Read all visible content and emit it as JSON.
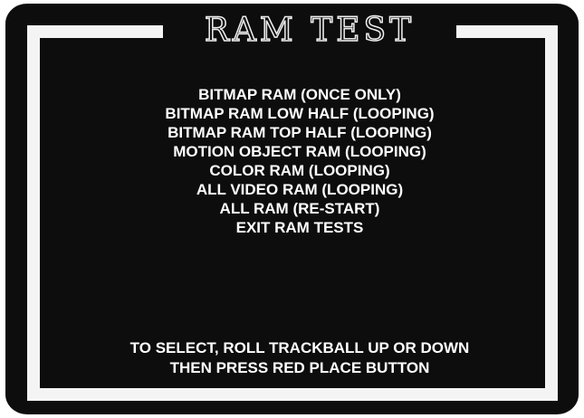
{
  "screen": {
    "title": "RAM TEST",
    "menu_items": [
      "BITMAP RAM (ONCE ONLY)",
      "BITMAP RAM LOW HALF (LOOPING)",
      "BITMAP RAM TOP HALF (LOOPING)",
      "MOTION OBJECT RAM (LOOPING)",
      "COLOR RAM (LOOPING)",
      "ALL VIDEO RAM (LOOPING)",
      "ALL RAM (RE-START)",
      "EXIT RAM TESTS"
    ],
    "instructions": [
      "TO SELECT, ROLL TRACKBALL UP OR DOWN",
      "THEN PRESS RED PLACE BUTTON"
    ]
  },
  "colors": {
    "background": "#0d0d0d",
    "text": "#ffffff",
    "frame": "#f4f4f4"
  }
}
